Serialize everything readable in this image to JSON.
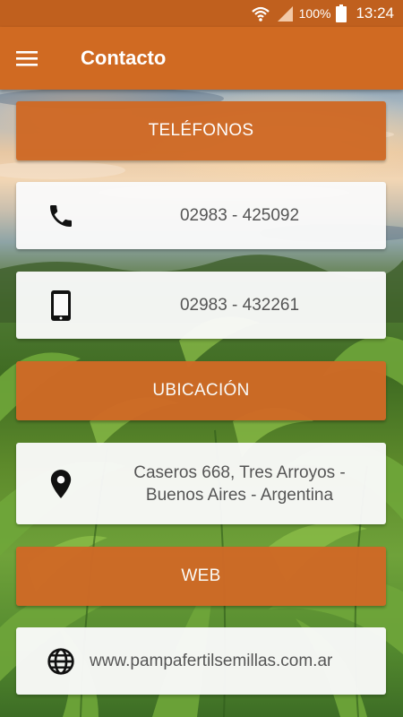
{
  "status_bar": {
    "battery_text": "100%",
    "time": "13:24",
    "icons": [
      "wifi-icon",
      "signal-icon",
      "battery-icon"
    ]
  },
  "app_bar": {
    "title": "Contacto",
    "menu_icon": "hamburger-menu-icon"
  },
  "sections": {
    "phones_header": "TELÉFONOS",
    "phone_landline": "02983 - 425092",
    "phone_mobile": "02983 - 432261",
    "location_header": "UBICACIÓN",
    "address_line1": "Caseros 668, Tres Arroyos -",
    "address_line2": "Buenos Aires - Argentina",
    "web_header": "WEB",
    "website": "www.pampafertilsemillas.com.ar"
  },
  "colors": {
    "status_bar": "#c0601e",
    "app_bar": "#d06a22",
    "section_header": "#cf6a26",
    "card_background": "#fafafa",
    "card_text": "#555555"
  }
}
